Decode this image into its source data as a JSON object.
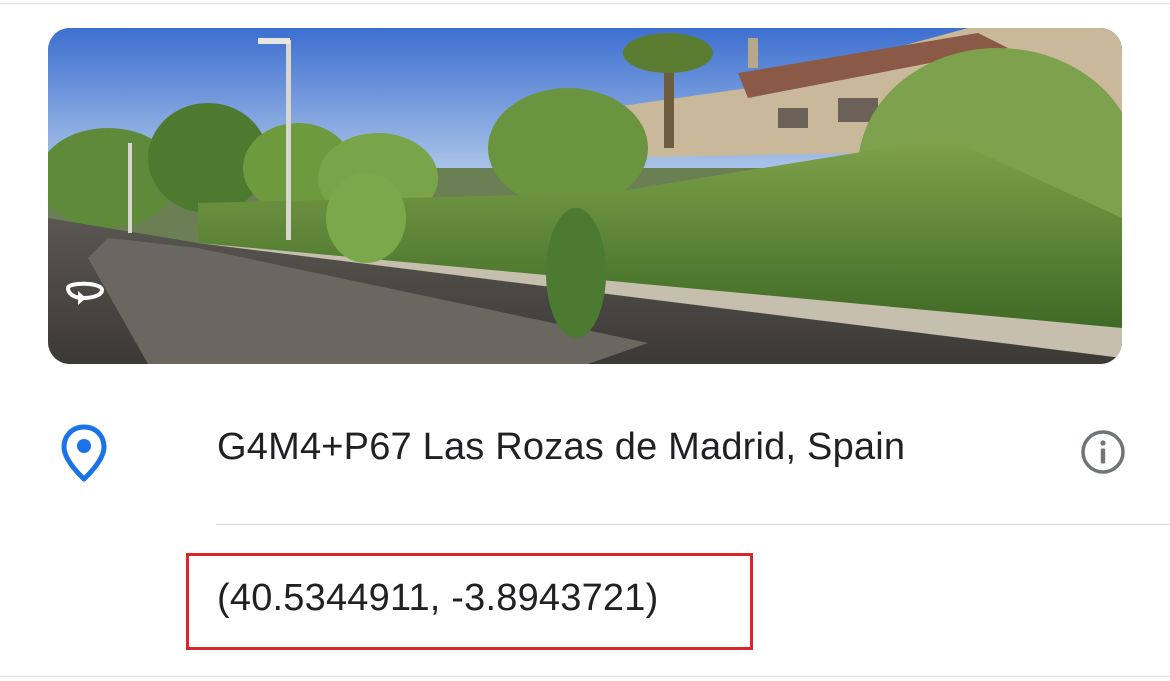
{
  "place": {
    "photo_alt": "Street View image",
    "address": "G4M4+P67 Las Rozas de Madrid, Spain",
    "coordinates": "(40.5344911, -3.8943721)"
  },
  "icons": {
    "photo_overlay": "street-view-360-icon",
    "location": "location-pin-icon",
    "info": "info-icon"
  },
  "colors": {
    "pin_blue": "#1a73e8",
    "text": "#202124",
    "info_gray": "#70757a",
    "highlight_red": "#d9262b"
  }
}
